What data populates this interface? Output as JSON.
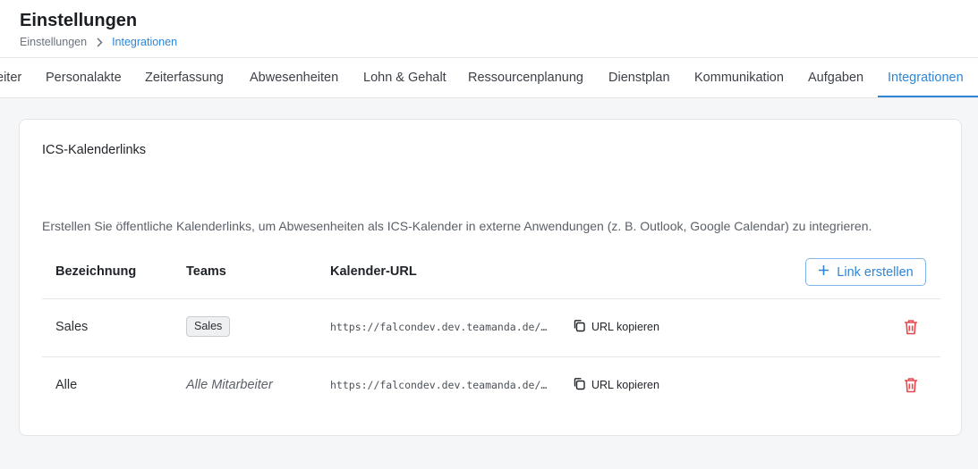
{
  "header": {
    "title": "Einstellungen",
    "breadcrumb": [
      "Einstellungen",
      "Integrationen"
    ]
  },
  "tabs": [
    {
      "label": "eiter",
      "active": false
    },
    {
      "label": "Personalakte",
      "active": false
    },
    {
      "label": "Zeiterfassung",
      "active": false
    },
    {
      "label": "Abwesenheiten",
      "active": false
    },
    {
      "label": "Lohn & Gehalt",
      "active": false
    },
    {
      "label": "Ressourcenplanung",
      "active": false
    },
    {
      "label": "Dienstplan",
      "active": false
    },
    {
      "label": "Kommunikation",
      "active": false
    },
    {
      "label": "Aufgaben",
      "active": false
    },
    {
      "label": "Integrationen",
      "active": true
    }
  ],
  "card": {
    "title": "ICS-Kalenderlinks",
    "description": "Erstellen Sie öffentliche Kalenderlinks, um Abwesenheiten als ICS-Kalender in externe Anwendungen (z. B. Outlook, Google Calendar) zu integrieren.",
    "columns": [
      "Bezeichnung",
      "Teams",
      "Kalender-URL"
    ],
    "create_button": "Link erstellen",
    "rows": [
      {
        "name": "Sales",
        "team_chip": "Sales",
        "team_text": "",
        "url": "https://falcondev.dev.teamanda.de/…",
        "copy_label": "URL kopieren"
      },
      {
        "name": "Alle",
        "team_chip": "",
        "team_text": "Alle Mitarbeiter",
        "url": "https://falcondev.dev.teamanda.de/…",
        "copy_label": "URL kopieren"
      }
    ]
  },
  "colors": {
    "accent": "#2f86d6",
    "danger": "#e5484d",
    "border": "#e3e5e8"
  },
  "icons": [
    "chevron-right-icon",
    "plus-icon",
    "copy-icon",
    "trash-icon"
  ]
}
